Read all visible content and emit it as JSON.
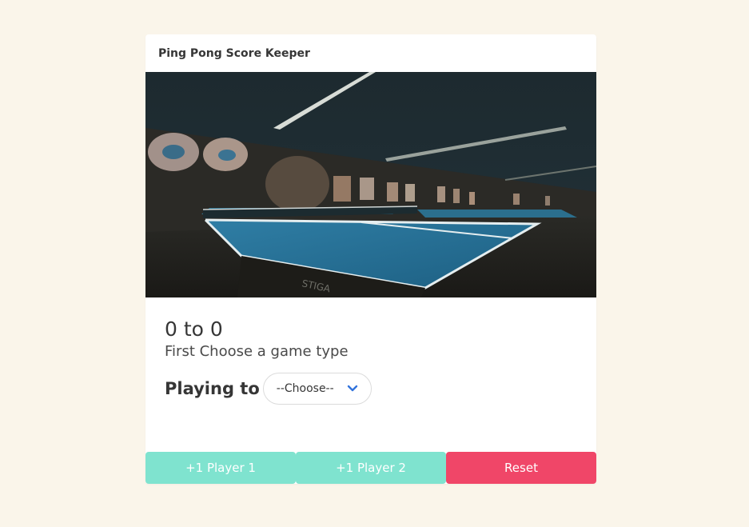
{
  "card": {
    "title": "Ping Pong Score Keeper",
    "image_alt": "ping pong table in a dim hall",
    "score": "0 to 0",
    "subtitle": "First Choose a game type",
    "playing_label": "Playing to",
    "select": {
      "value": "--Choose--",
      "icon": "chevron-down-icon"
    },
    "buttons": {
      "player1": "+1 Player 1",
      "player2": "+1 Player 2",
      "reset": "Reset"
    }
  },
  "colors": {
    "background": "#faf5ea",
    "player_button": "#7fe3cf",
    "reset_button": "#f04668",
    "chevron": "#3273dc"
  }
}
